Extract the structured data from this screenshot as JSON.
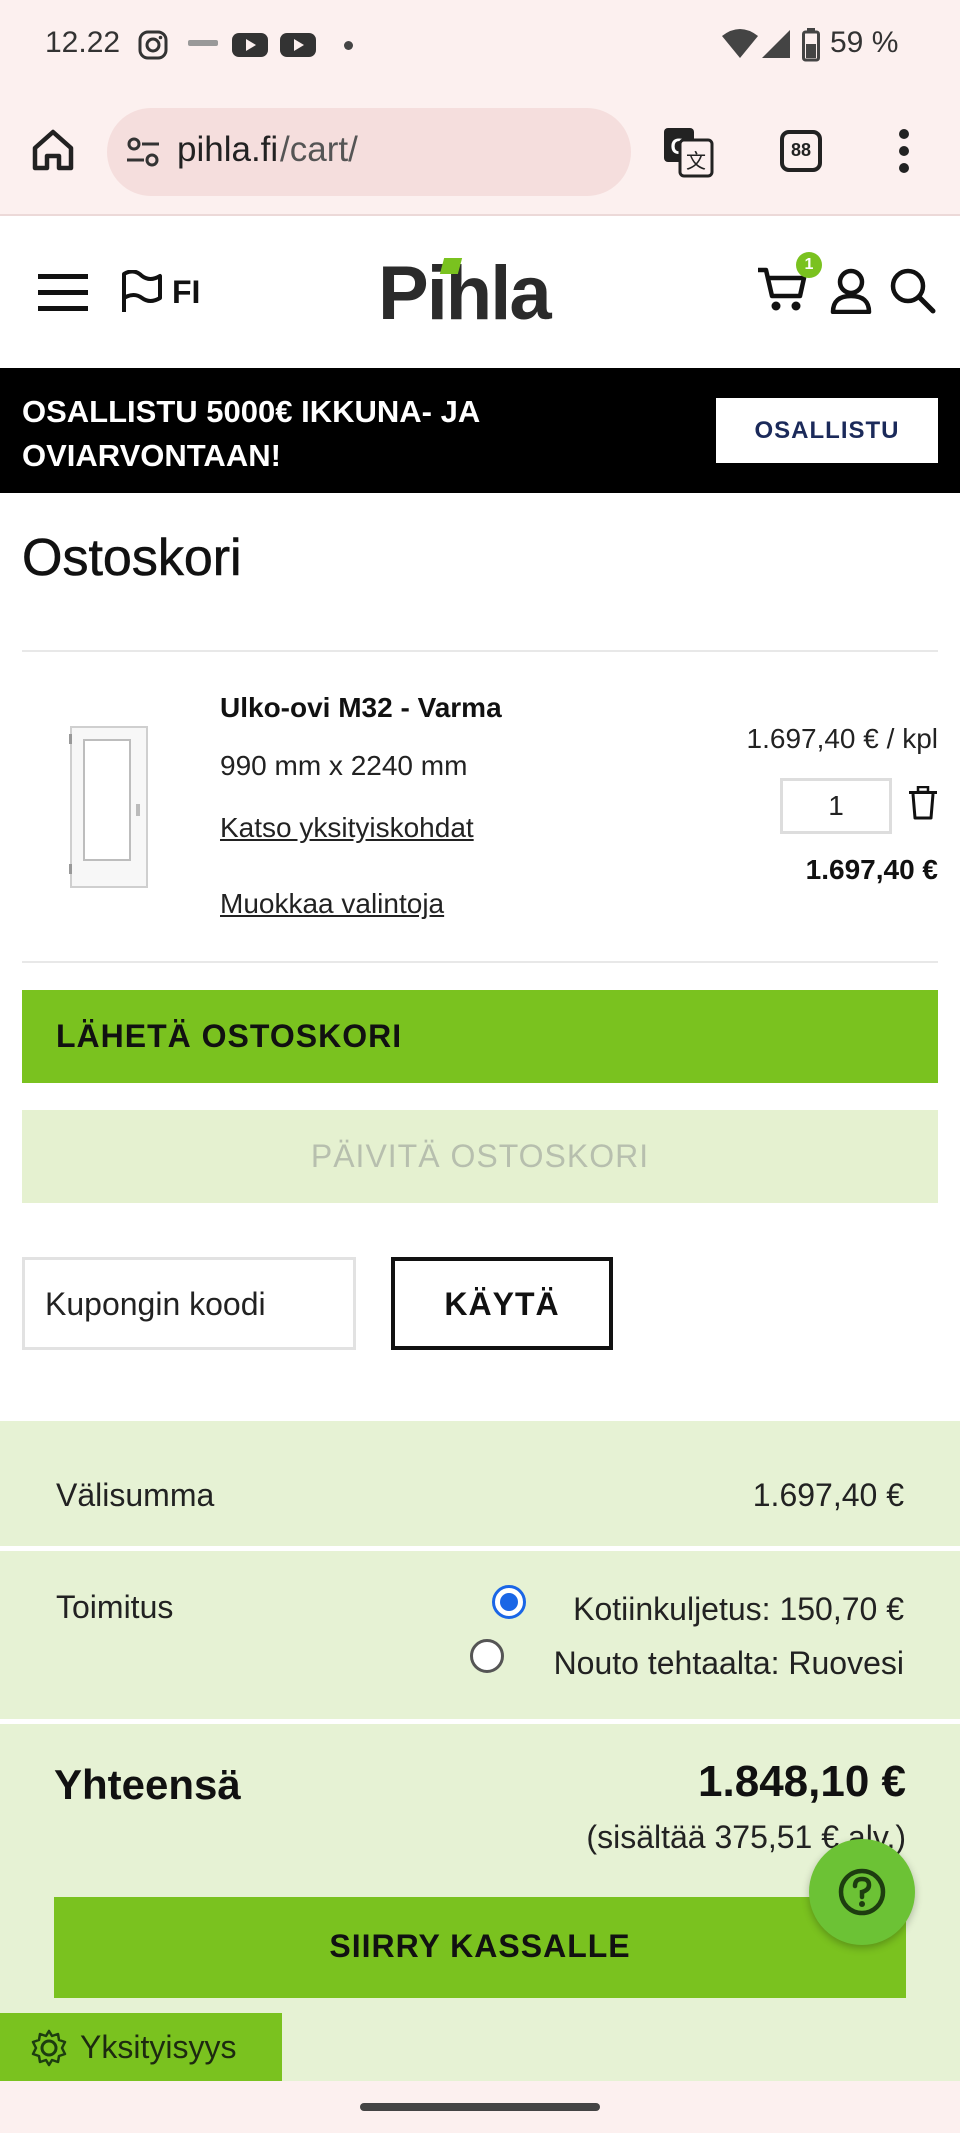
{
  "status_bar": {
    "time": "12.22",
    "battery": "59 %"
  },
  "browser": {
    "url_host": "pihla.fi",
    "url_path": "/cart/",
    "tabs_count": "88"
  },
  "site_header": {
    "language": "FI",
    "logo": "Pihla",
    "cart_count": "1"
  },
  "banner": {
    "text_line1": "OSALLISTU 5000€ IKKUNA- JA",
    "text_line2": "OVIARVONTAAN!",
    "button": "OSALLISTU"
  },
  "page": {
    "title": "Ostoskori"
  },
  "cart_item": {
    "name": "Ulko-ovi M32 - Varma",
    "dimensions": "990 mm x 2240 mm",
    "details_link": "Katso yksityiskohdat",
    "edit_link": "Muokkaa valintoja",
    "unit_price": "1.697,40 € / kpl",
    "quantity": "1",
    "line_total": "1.697,40 €"
  },
  "actions": {
    "send_cart": "LÄHETÄ OSTOSKORI",
    "update_cart": "PÄIVITÄ OSTOSKORI",
    "coupon_placeholder": "Kupongin koodi",
    "apply": "KÄYTÄ"
  },
  "totals": {
    "subtotal_label": "Välisumma",
    "subtotal_value": "1.697,40 €",
    "shipping_label": "Toimitus",
    "shipping_options": [
      {
        "label": "Kotiinkuljetus: 150,70 €",
        "selected": true
      },
      {
        "label": "Nouto tehtaalta: Ruovesi",
        "selected": false
      }
    ],
    "total_label": "Yhteensä",
    "total_value": "1.848,10 €",
    "vat_note": "(sisältää 375,51 € alv.)",
    "checkout": "SIIRRY KASSALLE"
  },
  "privacy": {
    "label": "Yksityisyys"
  },
  "colors": {
    "brand_green": "#7ac21f",
    "light_green": "#e6f2d4",
    "browser_bg": "#fcf0ef"
  }
}
